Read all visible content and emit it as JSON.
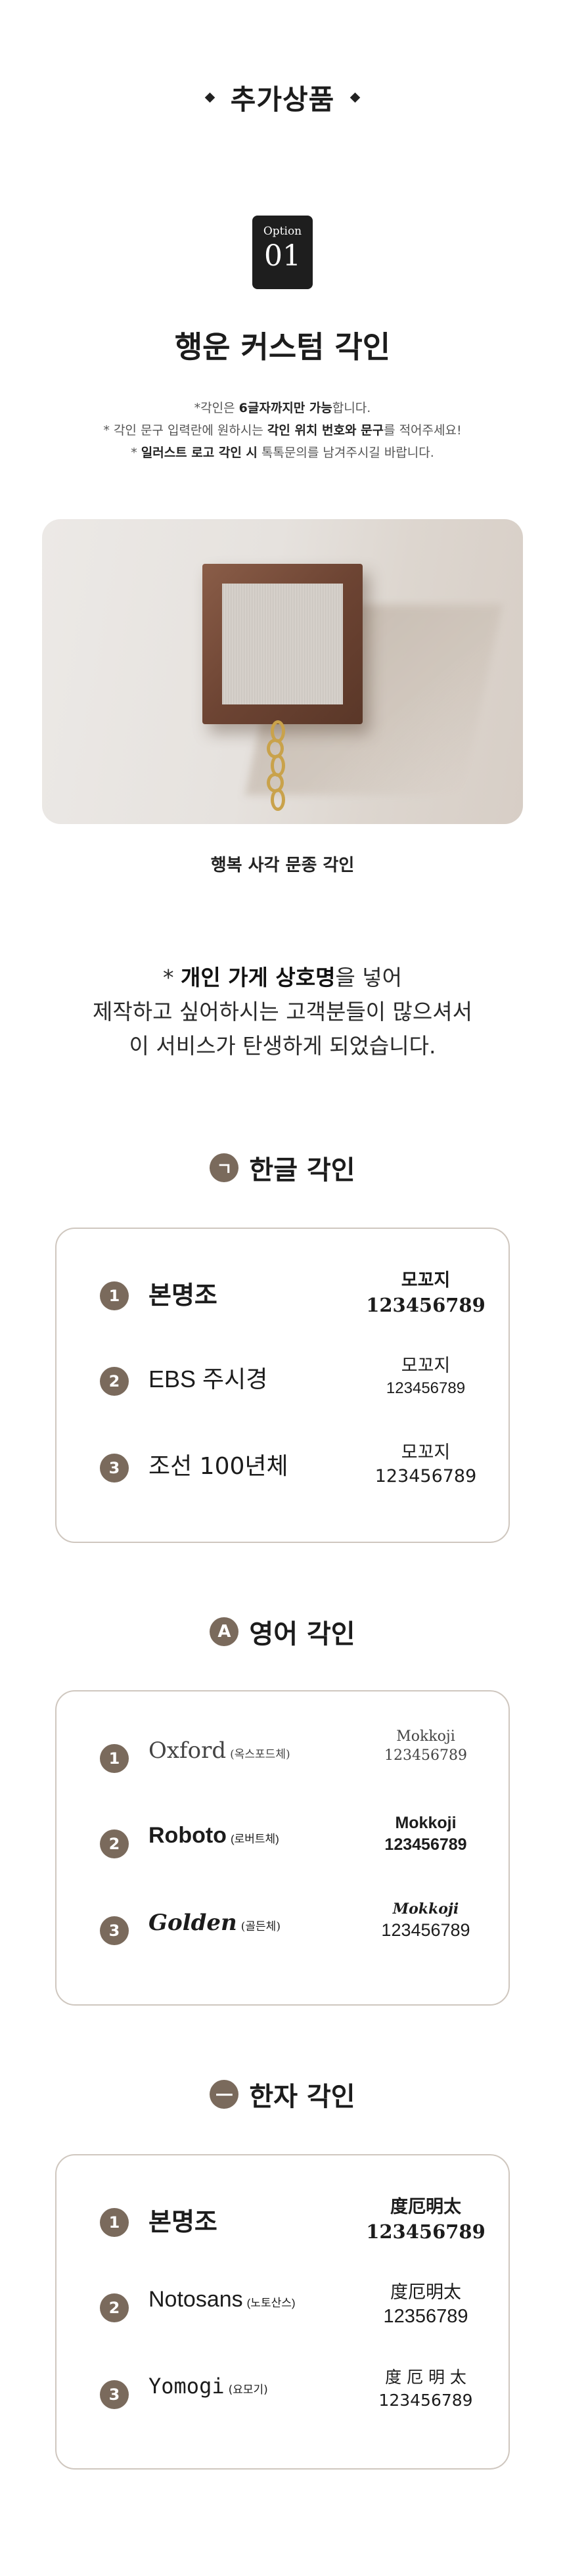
{
  "header": {
    "title": "추가상품"
  },
  "option": {
    "small": "Option",
    "number": "01"
  },
  "product": {
    "title": "행운 커스텀 각인"
  },
  "notes": {
    "l1_a": "*각인은 ",
    "l1_b": "6글자까지만 가능",
    "l1_c": "합니다.",
    "l2_a": "* 각인 문구 입력란에 원하시는 ",
    "l2_b": "각인 위치 번호와 문구",
    "l2_c": "를 적어주세요!",
    "l3_a": "* ",
    "l3_b": "일러스트 로고 각인 시",
    "l3_c": " 톡톡문의를 남겨주시길 바랍니다."
  },
  "photo": {
    "caption": "행복 사각 문종 각인"
  },
  "intro": {
    "l1_a": "* ",
    "l1_b": "개인 가게 상호명",
    "l1_c": "을 넣어",
    "l2": "제작하고 싶어하시는 고객분들이 많으셔서",
    "l3": "이 서비스가 탄생하게 되었습니다."
  },
  "korean": {
    "icon": "ㄱ",
    "title": "한글 각인",
    "rows": [
      {
        "num": "1",
        "name": "본명조",
        "sub": "",
        "sample_text": "모꼬지",
        "sample_num": "123456789"
      },
      {
        "num": "2",
        "name": "EBS 주시경",
        "sub": "",
        "sample_text": "모꼬지",
        "sample_num": "123456789"
      },
      {
        "num": "3",
        "name": "조선 100년체",
        "sub": "",
        "sample_text": "모꼬지",
        "sample_num": "123456789"
      }
    ]
  },
  "english": {
    "icon": "A",
    "title": "영어 각인",
    "rows": [
      {
        "num": "1",
        "name": "Oxford",
        "sub": "(옥스포드체)",
        "sample_text": "Mokkoji",
        "sample_num": "123456789"
      },
      {
        "num": "2",
        "name": "Roboto",
        "sub": "(로버트체)",
        "sample_text": "Mokkoji",
        "sample_num": "123456789"
      },
      {
        "num": "3",
        "name": "Golden",
        "sub": "(골든체)",
        "sample_text": "Mokkoji",
        "sample_num": "123456789"
      }
    ]
  },
  "hanja": {
    "icon": "一",
    "title": "한자 각인",
    "rows": [
      {
        "num": "1",
        "name": "본명조",
        "sub": "",
        "sample_text": "度厄明太",
        "sample_num": "123456789"
      },
      {
        "num": "2",
        "name": "Notosans",
        "sub": "(노토산스)",
        "sample_text": "度厄明太",
        "sample_num": "12356789"
      },
      {
        "num": "3",
        "name": "Yomogi",
        "sub": "(요모기)",
        "sample_text": "度 厄 明 太",
        "sample_num": "123456789"
      }
    ]
  },
  "colors": {
    "accent": "#7a6a5c",
    "border": "#cfc7bf",
    "dark": "#1e1e1e"
  }
}
